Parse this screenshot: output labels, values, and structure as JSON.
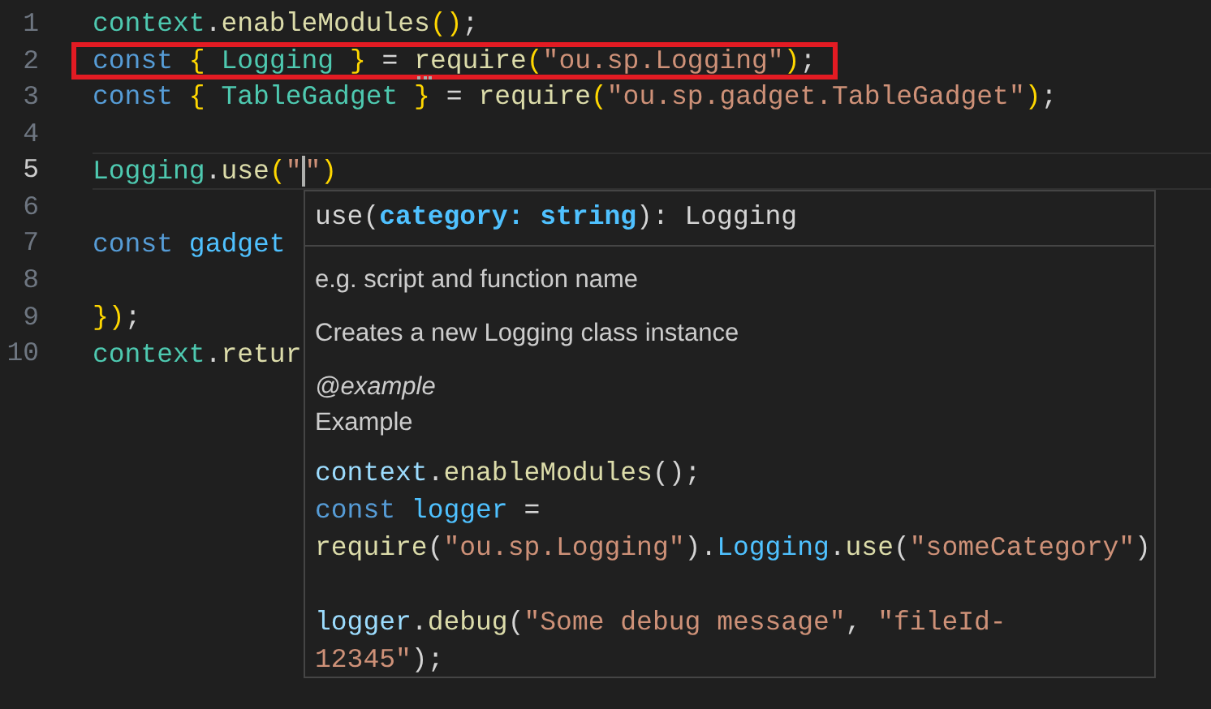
{
  "editor": {
    "lines": [
      {
        "number": "1",
        "current": false,
        "boxed": false,
        "tokens": [
          {
            "kind": "class",
            "text": "context"
          },
          {
            "kind": "punct",
            "text": "."
          },
          {
            "kind": "func",
            "text": "enableModules"
          },
          {
            "kind": "bracket",
            "text": "()"
          },
          {
            "kind": "punct",
            "text": ";"
          }
        ]
      },
      {
        "number": "2",
        "current": false,
        "boxed": true,
        "tokens": [
          {
            "kind": "keyword",
            "text": "const "
          },
          {
            "kind": "bracket",
            "text": "{ "
          },
          {
            "kind": "class",
            "text": "Logging"
          },
          {
            "kind": "bracket",
            "text": " }"
          },
          {
            "kind": "punct",
            "text": " = "
          },
          {
            "kind": "func",
            "text": "require",
            "hint": true
          },
          {
            "kind": "bracket",
            "text": "("
          },
          {
            "kind": "string",
            "text": "\"ou.sp.Logging\""
          },
          {
            "kind": "bracket",
            "text": ")"
          },
          {
            "kind": "punct",
            "text": ";"
          }
        ]
      },
      {
        "number": "3",
        "current": false,
        "boxed": false,
        "tokens": [
          {
            "kind": "keyword",
            "text": "const "
          },
          {
            "kind": "bracket",
            "text": "{ "
          },
          {
            "kind": "class",
            "text": "TableGadget"
          },
          {
            "kind": "bracket",
            "text": " }"
          },
          {
            "kind": "punct",
            "text": " = "
          },
          {
            "kind": "func",
            "text": "require"
          },
          {
            "kind": "bracket",
            "text": "("
          },
          {
            "kind": "string",
            "text": "\"ou.sp.gadget.TableGadget\""
          },
          {
            "kind": "bracket",
            "text": ")"
          },
          {
            "kind": "punct",
            "text": ";"
          }
        ]
      },
      {
        "number": "4",
        "current": false,
        "boxed": false
      },
      {
        "number": "5",
        "current": true,
        "boxed": false,
        "tokens": [
          {
            "kind": "class",
            "text": "Logging"
          },
          {
            "kind": "punct",
            "text": "."
          },
          {
            "kind": "func",
            "text": "use"
          },
          {
            "kind": "bracket",
            "text": "("
          },
          {
            "kind": "string",
            "text": "\""
          },
          {
            "kind": "cursor"
          },
          {
            "kind": "string",
            "text": "\""
          },
          {
            "kind": "bracket",
            "text": ")"
          }
        ]
      },
      {
        "number": "6",
        "current": false,
        "boxed": false
      },
      {
        "number": "7",
        "current": false,
        "boxed": false,
        "tokens": [
          {
            "kind": "keyword",
            "text": "const "
          },
          {
            "kind": "const",
            "text": "gadget"
          }
        ]
      },
      {
        "number": "8",
        "current": false,
        "boxed": false
      },
      {
        "number": "9",
        "current": false,
        "boxed": false,
        "tokens": [
          {
            "kind": "bracket",
            "text": "})"
          },
          {
            "kind": "punct",
            "text": ";"
          }
        ]
      },
      {
        "number": "10",
        "current": false,
        "boxed": false,
        "tokens": [
          {
            "kind": "class",
            "text": "context"
          },
          {
            "kind": "punct",
            "text": "."
          },
          {
            "kind": "func",
            "text": "retur"
          }
        ]
      }
    ]
  },
  "hover": {
    "signature": [
      {
        "kind": "punct",
        "text": "use("
      },
      {
        "kind": "param",
        "text": "category: string"
      },
      {
        "kind": "punct",
        "text": "): Logging"
      }
    ],
    "docs": [
      {
        "kind": "text",
        "text": "e.g. script and function name"
      },
      {
        "kind": "text",
        "text": "Creates a new Logging class instance"
      },
      {
        "kind": "tag",
        "text": "@example"
      },
      {
        "kind": "heading",
        "text": "Example"
      }
    ],
    "example_blocks": [
      [
        [
          {
            "kind": "var",
            "text": "context"
          },
          {
            "kind": "punct",
            "text": "."
          },
          {
            "kind": "func",
            "text": "enableModules"
          },
          {
            "kind": "punct",
            "text": "();"
          }
        ],
        [
          {
            "kind": "keyword",
            "text": "const "
          },
          {
            "kind": "const",
            "text": "logger"
          },
          {
            "kind": "punct",
            "text": " ="
          }
        ],
        [
          {
            "kind": "func",
            "text": "require"
          },
          {
            "kind": "punct",
            "text": "("
          },
          {
            "kind": "string",
            "text": "\"ou.sp.Logging\""
          },
          {
            "kind": "punct",
            "text": ")."
          },
          {
            "kind": "const",
            "text": "Logging"
          },
          {
            "kind": "punct",
            "text": "."
          },
          {
            "kind": "func",
            "text": "use"
          },
          {
            "kind": "punct",
            "text": "("
          },
          {
            "kind": "string",
            "text": "\"someCategory\""
          },
          {
            "kind": "punct",
            "text": ")"
          }
        ]
      ],
      [
        [
          {
            "kind": "var",
            "text": "logger"
          },
          {
            "kind": "punct",
            "text": "."
          },
          {
            "kind": "func",
            "text": "debug"
          },
          {
            "kind": "punct",
            "text": "("
          },
          {
            "kind": "string",
            "text": "\"Some debug message\""
          },
          {
            "kind": "punct",
            "text": ", "
          },
          {
            "kind": "string",
            "text": "\"fileId-"
          }
        ],
        [
          {
            "kind": "string",
            "text": "12345\""
          },
          {
            "kind": "punct",
            "text": ");"
          }
        ]
      ]
    ]
  }
}
